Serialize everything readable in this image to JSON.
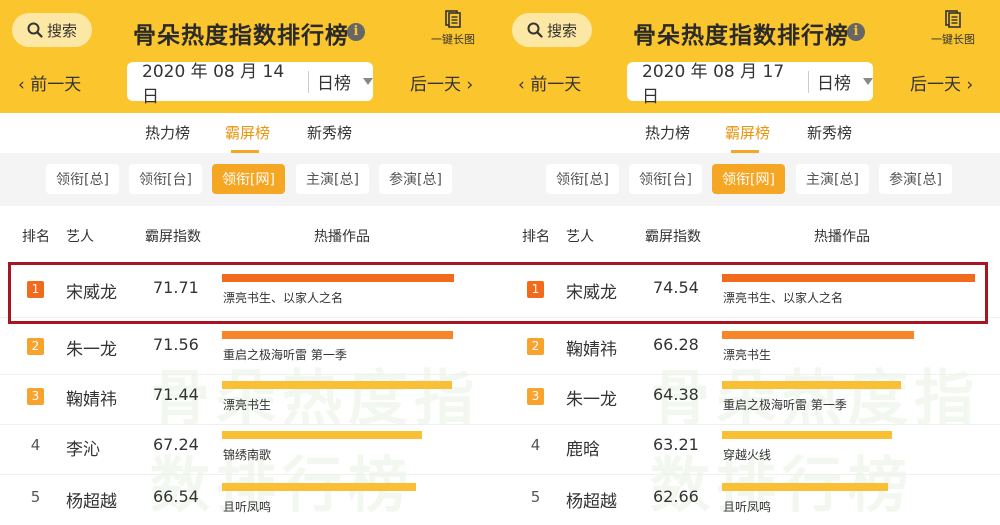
{
  "panels": [
    {
      "search_label": "搜索",
      "title": "骨朵热度指数排行榜",
      "longpic_label": "一键长图",
      "prev_label": "前一天",
      "next_label": "后一天",
      "date": "2020 年 08 月 14 日",
      "period": "日榜",
      "tabs": [
        "热力榜",
        "霸屏榜",
        "新秀榜"
      ],
      "active_tab": 1,
      "filters": [
        "领衔[总]",
        "领衔[台]",
        "领衔[网]",
        "主演[总]",
        "参演[总]"
      ],
      "active_filter": 2,
      "columns": [
        "排名",
        "艺人",
        "霸屏指数",
        "热播作品"
      ],
      "rows": [
        {
          "rank": "1",
          "artist": "宋威龙",
          "score": "71.71",
          "work": "漂亮书生、以家人之名",
          "value": 71.71
        },
        {
          "rank": "2",
          "artist": "朱一龙",
          "score": "71.56",
          "work": "重启之极海听雷 第一季",
          "value": 71.56
        },
        {
          "rank": "3",
          "artist": "鞠婧祎",
          "score": "71.44",
          "work": "漂亮书生",
          "value": 71.44
        },
        {
          "rank": "4",
          "artist": "李沁",
          "score": "67.24",
          "work": "锦绣南歌",
          "value": 67.24
        },
        {
          "rank": "5",
          "artist": "杨超越",
          "score": "66.54",
          "work": "且听凤鸣",
          "value": 66.54
        }
      ]
    },
    {
      "search_label": "搜索",
      "title": "骨朵热度指数排行榜",
      "longpic_label": "一键长图",
      "prev_label": "前一天",
      "next_label": "后一天",
      "date": "2020 年 08 月 17 日",
      "period": "日榜",
      "tabs": [
        "热力榜",
        "霸屏榜",
        "新秀榜"
      ],
      "active_tab": 1,
      "filters": [
        "领衔[总]",
        "领衔[台]",
        "领衔[网]",
        "主演[总]",
        "参演[总]"
      ],
      "active_filter": 2,
      "columns": [
        "排名",
        "艺人",
        "霸屏指数",
        "热播作品"
      ],
      "rows": [
        {
          "rank": "1",
          "artist": "宋威龙",
          "score": "74.54",
          "work": "漂亮书生、以家人之名",
          "value": 74.54
        },
        {
          "rank": "2",
          "artist": "鞠婧祎",
          "score": "66.28",
          "work": "漂亮书生",
          "value": 66.28
        },
        {
          "rank": "3",
          "artist": "朱一龙",
          "score": "64.38",
          "work": "重启之极海听雷 第一季",
          "value": 64.38
        },
        {
          "rank": "4",
          "artist": "鹿晗",
          "score": "63.21",
          "work": "穿越火线",
          "value": 63.21
        },
        {
          "rank": "5",
          "artist": "杨超越",
          "score": "62.66",
          "work": "且听凤鸣",
          "value": 62.66
        }
      ]
    }
  ],
  "colors": {
    "header": "#fbc52d",
    "accent": "#f5a623",
    "bar_top": "#f26b1d",
    "bar_mid": "#f5862a",
    "bar_low": "#f9c036",
    "rank1": "#f26b1d",
    "rank23": "#f7a32d",
    "highlight": "#a51620"
  },
  "icons": {
    "search": "search-icon",
    "info": "info-icon",
    "longpic": "document-icon",
    "prev": "chevron-left-icon",
    "next": "chevron-right-icon",
    "caret": "caret-down-icon"
  }
}
